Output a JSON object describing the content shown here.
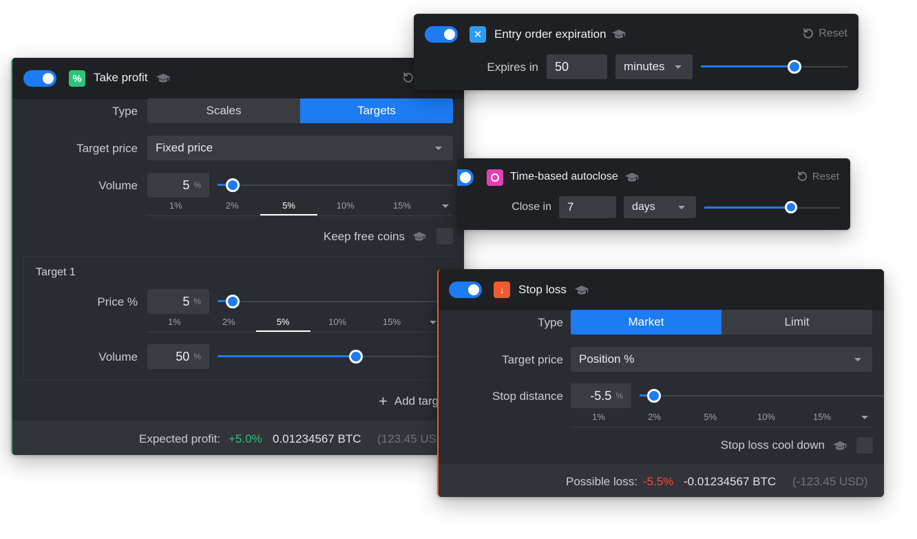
{
  "icons": {
    "graduation": "graduation-cap-icon",
    "reset": "reset-icon",
    "caret": "caret-down-icon",
    "plus": "plus-icon"
  },
  "colors": {
    "accent": "#1d7bf4",
    "take_profit_badge": "#2bc37a",
    "expiration_badge": "#2d9cf0",
    "autoclose_badge": "#e63fb4",
    "stop_loss_badge": "#f05a2e",
    "profit_green": "#27c17b",
    "loss_red": "#ef4b3f"
  },
  "take_profit": {
    "title": "Take profit",
    "type_label": "Type",
    "type_options": [
      "Scales",
      "Targets"
    ],
    "type_selected": "Targets",
    "target_price_label": "Target price",
    "target_price_value": "Fixed price",
    "volume_label": "Volume",
    "volume_value": "5",
    "unit": "%",
    "volume_presets": [
      "1%",
      "2%",
      "5%",
      "10%",
      "15%"
    ],
    "volume_preset_selected": "5%",
    "keep_free_coins_label": "Keep free coins",
    "target": {
      "title": "Target 1",
      "price_label": "Price %",
      "price_value": "5",
      "price_presets": [
        "1%",
        "2%",
        "5%",
        "10%",
        "15%"
      ],
      "price_preset_selected": "5%",
      "volume_label": "Volume",
      "volume_value": "50"
    },
    "add_target_label": "Add targ",
    "expected_profit_label": "Expected profit:",
    "expected_profit_pct": "+5.0%",
    "expected_profit_btc": "0.01234567 BTC",
    "expected_profit_usd": "(123.45 US"
  },
  "expiration": {
    "title": "Entry order expiration",
    "reset_label": "Reset",
    "expires_label": "Expires in",
    "expires_value": "50",
    "unit_value": "minutes",
    "slider_fraction": 0.63
  },
  "autoclose": {
    "title": "Time-based autoclose",
    "reset_label": "Reset",
    "close_label": "Close in",
    "close_value": "7",
    "unit_value": "days",
    "slider_fraction": 0.64
  },
  "stop_loss": {
    "title": "Stop loss",
    "type_label": "Type",
    "type_options": [
      "Market",
      "Limit"
    ],
    "type_selected": "Market",
    "target_price_label": "Target price",
    "target_price_value": "Position %",
    "distance_label": "Stop distance",
    "distance_value": "-5.5",
    "unit": "%",
    "presets": [
      "1%",
      "2%",
      "5%",
      "10%",
      "15%"
    ],
    "cool_down_label": "Stop loss cool down",
    "possible_loss_label": "Possible loss:",
    "possible_loss_pct": "-5.5%",
    "possible_loss_btc": "-0.01234567 BTC",
    "possible_loss_usd": "(-123.45 USD)"
  }
}
